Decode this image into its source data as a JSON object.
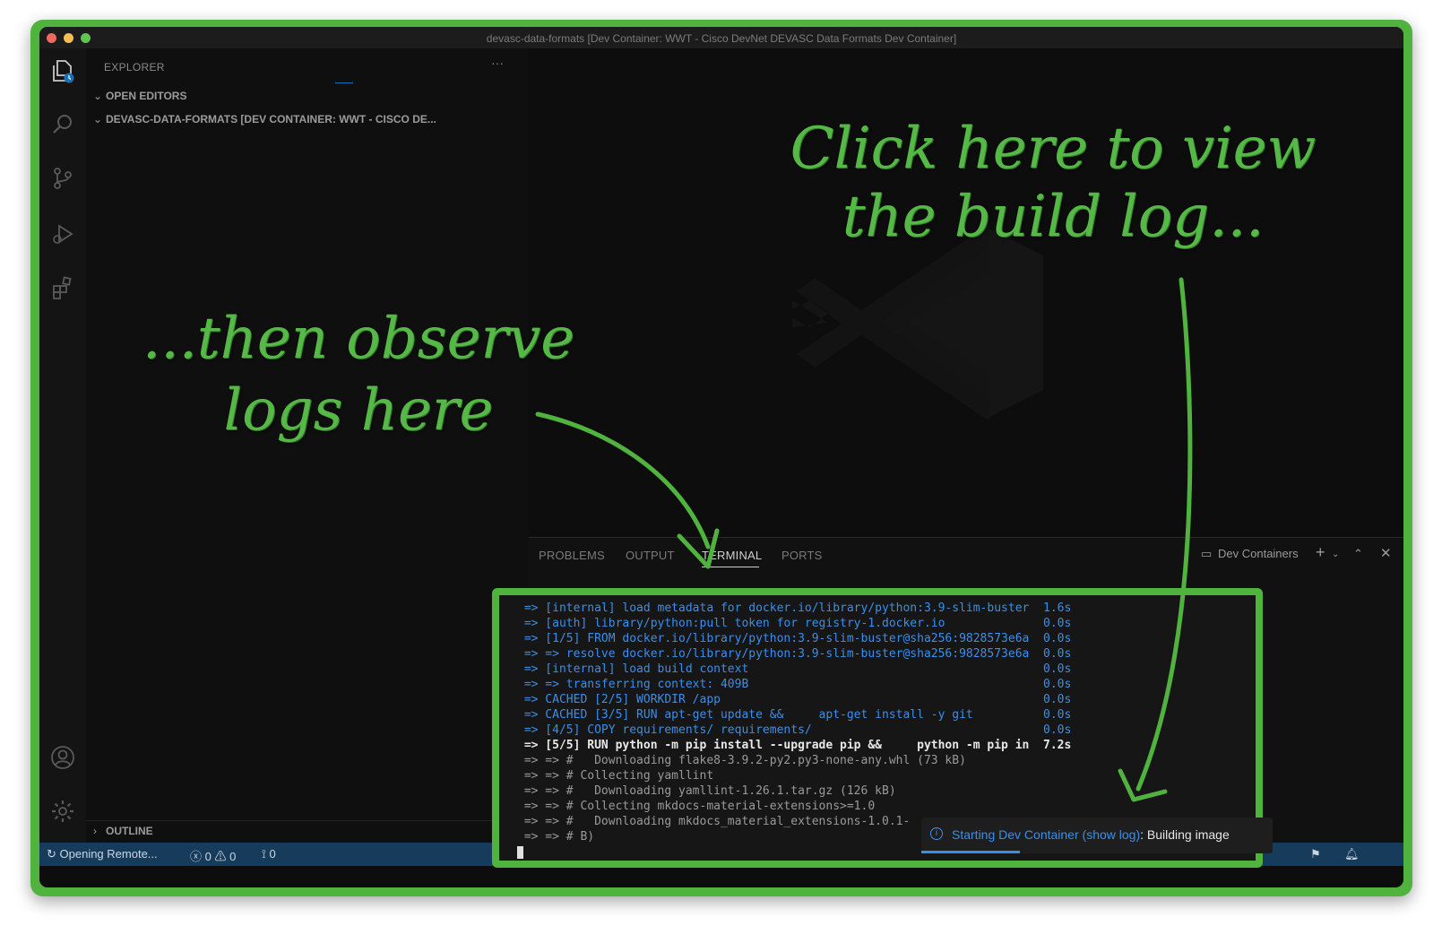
{
  "window": {
    "title": "devasc-data-formats [Dev Container: WWT - Cisco DevNet DEVASC Data Formats Dev Container]"
  },
  "sidebar": {
    "header": "EXPLORER",
    "more": "···",
    "open_editors": "OPEN EDITORS",
    "folder": "DEVASC-DATA-FORMATS [DEV CONTAINER: WWT - CISCO DE...",
    "outline": "OUTLINE"
  },
  "activity_bar": {
    "icons": [
      "explorer-icon",
      "search-icon",
      "source-control-icon",
      "run-debug-icon",
      "extensions-icon",
      "account-icon",
      "gear-icon"
    ]
  },
  "panel": {
    "tabs": [
      {
        "label": "PROBLEMS"
      },
      {
        "label": "OUTPUT"
      },
      {
        "label": "TERMINAL"
      },
      {
        "label": "PORTS"
      }
    ],
    "active_tab": "TERMINAL",
    "terminal_name": "Dev Containers",
    "terminal_lines": [
      {
        "text": " => [internal] load metadata for docker.io/library/python:3.9-slim-buster  1.6s",
        "color": "blue"
      },
      {
        "text": " => [auth] library/python:pull token for registry-1.docker.io              0.0s",
        "color": "blue"
      },
      {
        "text": " => [1/5] FROM docker.io/library/python:3.9-slim-buster@sha256:9828573e6a  0.0s",
        "color": "blue"
      },
      {
        "text": " => => resolve docker.io/library/python:3.9-slim-buster@sha256:9828573e6a  0.0s",
        "color": "blue"
      },
      {
        "text": " => [internal] load build context                                          0.0s",
        "color": "blue"
      },
      {
        "text": " => => transferring context: 409B                                          0.0s",
        "color": "blue"
      },
      {
        "text": " => CACHED [2/5] WORKDIR /app                                              0.0s",
        "color": "blue"
      },
      {
        "text": " => CACHED [3/5] RUN apt-get update &&     apt-get install -y git          0.0s",
        "color": "blue"
      },
      {
        "text": " => [4/5] COPY requirements/ requirements/                                 0.0s",
        "color": "blue"
      },
      {
        "text": " => [5/5] RUN python -m pip install --upgrade pip &&     python -m pip in  7.2s",
        "color": "white"
      },
      {
        "text": " => => #   Downloading flake8-3.9.2-py2.py3-none-any.whl (73 kB)",
        "color": "gray"
      },
      {
        "text": " => => # Collecting yamllint",
        "color": "gray"
      },
      {
        "text": " => => #   Downloading yamllint-1.26.1.tar.gz (126 kB)",
        "color": "gray"
      },
      {
        "text": " => => # Collecting mkdocs-material-extensions>=1.0",
        "color": "gray"
      },
      {
        "text": " => => #   Downloading mkdocs_material_extensions-1.0.1-",
        "color": "gray"
      },
      {
        "text": " => => # B)",
        "color": "gray"
      }
    ]
  },
  "notification": {
    "prefix": "Starting Dev Container (",
    "link": "show log",
    "suffix": "): Building image"
  },
  "statusbar": {
    "remote": "Opening Remote...",
    "errors": "0",
    "warnings": "0",
    "ports": "0"
  },
  "annotations": {
    "top_line1": "Click here to view",
    "top_line2": "the build log...",
    "left_line1": "...then observe",
    "left_line2": "logs here"
  },
  "colors": {
    "accent_green": "#4fb33e",
    "terminal_blue": "#3b8eea",
    "statusbar": "#173b5a"
  }
}
